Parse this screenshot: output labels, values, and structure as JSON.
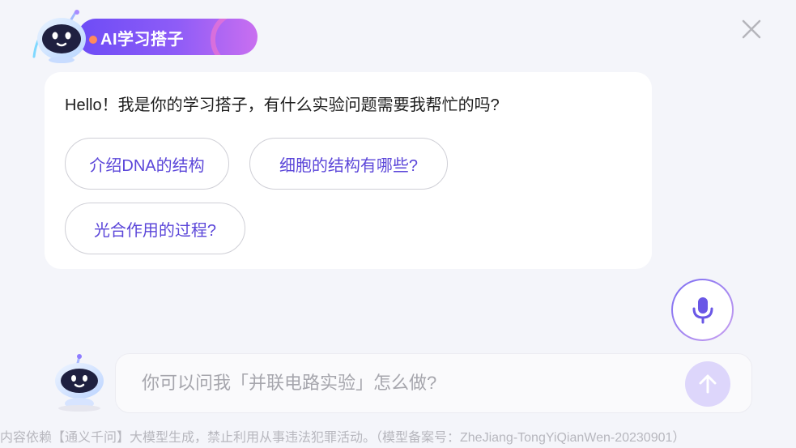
{
  "header": {
    "title": "AI学习搭子",
    "icon": "robot-mascot-icon",
    "accent_start": "#6d4cf6",
    "accent_end": "#c96ff0"
  },
  "close": {
    "icon": "close-icon"
  },
  "message": {
    "greeting": "Hello！我是你的学习搭子，有什么实验问题需要我帮忙的吗?",
    "suggestions": [
      "介绍DNA的结构",
      "细胞的结构有哪些?",
      "光合作用的过程?"
    ],
    "suggestion_color": "#5b46d9"
  },
  "mic": {
    "icon": "microphone-icon",
    "color": "#6a57e6"
  },
  "input": {
    "placeholder": "你可以问我「并联电路实验」怎么做?",
    "value": "",
    "send_icon": "arrow-up-icon"
  },
  "footer": {
    "disclaimer": "内容依赖【通义千问】大模型生成，禁止利用从事违法犯罪活动。（模型备案号：ZheJiang-TongYiQianWen-20230901）"
  }
}
